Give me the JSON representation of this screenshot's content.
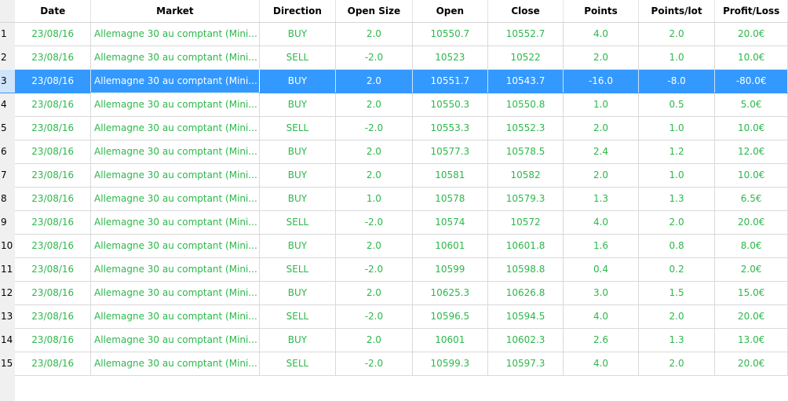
{
  "columns": [
    "Date",
    "Market",
    "Direction",
    "Open Size",
    "Open",
    "Close",
    "Points",
    "Points/lot",
    "Profit/Loss"
  ],
  "selected_row": 2,
  "colors": {
    "positive_text": "#2db84b",
    "selection_bg": "#3399ff",
    "header_bg": "#f0f0f0"
  },
  "rows": [
    {
      "num": "1",
      "date": "23/08/16",
      "market": "Allemagne 30 au comptant (Mini...",
      "direction": "BUY",
      "open_size": "2.0",
      "open": "10550.7",
      "close": "10552.7",
      "points": "4.0",
      "points_lot": "2.0",
      "pl": "20.0€"
    },
    {
      "num": "2",
      "date": "23/08/16",
      "market": "Allemagne 30 au comptant (Mini...",
      "direction": "SELL",
      "open_size": "-2.0",
      "open": "10523",
      "close": "10522",
      "points": "2.0",
      "points_lot": "1.0",
      "pl": "10.0€"
    },
    {
      "num": "3",
      "date": "23/08/16",
      "market": "Allemagne 30 au comptant (Mini...",
      "direction": "BUY",
      "open_size": "2.0",
      "open": "10551.7",
      "close": "10543.7",
      "points": "-16.0",
      "points_lot": "-8.0",
      "pl": "-80.0€"
    },
    {
      "num": "4",
      "date": "23/08/16",
      "market": "Allemagne 30 au comptant (Mini...",
      "direction": "BUY",
      "open_size": "2.0",
      "open": "10550.3",
      "close": "10550.8",
      "points": "1.0",
      "points_lot": "0.5",
      "pl": "5.0€"
    },
    {
      "num": "5",
      "date": "23/08/16",
      "market": "Allemagne 30 au comptant (Mini...",
      "direction": "SELL",
      "open_size": "-2.0",
      "open": "10553.3",
      "close": "10552.3",
      "points": "2.0",
      "points_lot": "1.0",
      "pl": "10.0€"
    },
    {
      "num": "6",
      "date": "23/08/16",
      "market": "Allemagne 30 au comptant (Mini...",
      "direction": "BUY",
      "open_size": "2.0",
      "open": "10577.3",
      "close": "10578.5",
      "points": "2.4",
      "points_lot": "1.2",
      "pl": "12.0€"
    },
    {
      "num": "7",
      "date": "23/08/16",
      "market": "Allemagne 30 au comptant (Mini...",
      "direction": "BUY",
      "open_size": "2.0",
      "open": "10581",
      "close": "10582",
      "points": "2.0",
      "points_lot": "1.0",
      "pl": "10.0€"
    },
    {
      "num": "8",
      "date": "23/08/16",
      "market": "Allemagne 30 au comptant (Mini...",
      "direction": "BUY",
      "open_size": "1.0",
      "open": "10578",
      "close": "10579.3",
      "points": "1.3",
      "points_lot": "1.3",
      "pl": "6.5€"
    },
    {
      "num": "9",
      "date": "23/08/16",
      "market": "Allemagne 30 au comptant (Mini...",
      "direction": "SELL",
      "open_size": "-2.0",
      "open": "10574",
      "close": "10572",
      "points": "4.0",
      "points_lot": "2.0",
      "pl": "20.0€"
    },
    {
      "num": "10",
      "date": "23/08/16",
      "market": "Allemagne 30 au comptant (Mini...",
      "direction": "BUY",
      "open_size": "2.0",
      "open": "10601",
      "close": "10601.8",
      "points": "1.6",
      "points_lot": "0.8",
      "pl": "8.0€"
    },
    {
      "num": "11",
      "date": "23/08/16",
      "market": "Allemagne 30 au comptant (Mini...",
      "direction": "SELL",
      "open_size": "-2.0",
      "open": "10599",
      "close": "10598.8",
      "points": "0.4",
      "points_lot": "0.2",
      "pl": "2.0€"
    },
    {
      "num": "12",
      "date": "23/08/16",
      "market": "Allemagne 30 au comptant (Mini...",
      "direction": "BUY",
      "open_size": "2.0",
      "open": "10625.3",
      "close": "10626.8",
      "points": "3.0",
      "points_lot": "1.5",
      "pl": "15.0€"
    },
    {
      "num": "13",
      "date": "23/08/16",
      "market": "Allemagne 30 au comptant (Mini...",
      "direction": "SELL",
      "open_size": "-2.0",
      "open": "10596.5",
      "close": "10594.5",
      "points": "4.0",
      "points_lot": "2.0",
      "pl": "20.0€"
    },
    {
      "num": "14",
      "date": "23/08/16",
      "market": "Allemagne 30 au comptant (Mini...",
      "direction": "BUY",
      "open_size": "2.0",
      "open": "10601",
      "close": "10602.3",
      "points": "2.6",
      "points_lot": "1.3",
      "pl": "13.0€"
    },
    {
      "num": "15",
      "date": "23/08/16",
      "market": "Allemagne 30 au comptant (Mini...",
      "direction": "SELL",
      "open_size": "-2.0",
      "open": "10599.3",
      "close": "10597.3",
      "points": "4.0",
      "points_lot": "2.0",
      "pl": "20.0€"
    }
  ]
}
